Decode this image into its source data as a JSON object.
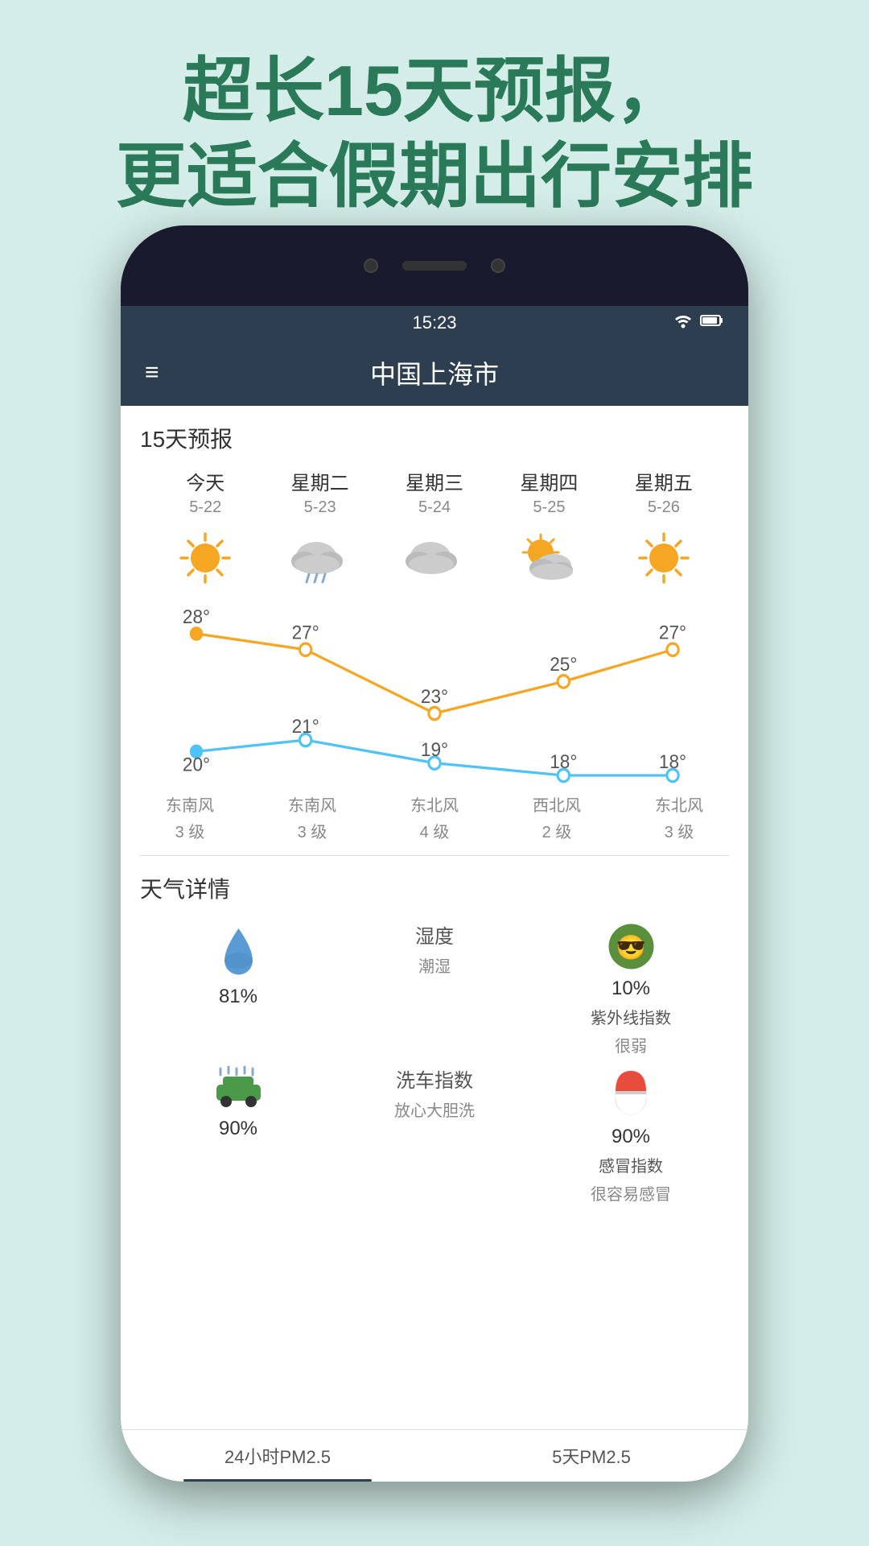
{
  "page": {
    "bg_color": "#d4ede8",
    "header_line1": "超长15天预报，",
    "header_line2": "更适合假期出行安排"
  },
  "status_bar": {
    "time": "15:23",
    "wifi_icon": "📶",
    "battery_icon": "🔋"
  },
  "app_header": {
    "menu_icon": "≡",
    "city": "中国上海市"
  },
  "forecast": {
    "section_title": "15天预报",
    "days": [
      {
        "name": "今天",
        "date": "5-22",
        "weather": "sunny",
        "high": "28°",
        "low": "20°",
        "wind_dir": "东南风",
        "wind_level": "3 级"
      },
      {
        "name": "星期二",
        "date": "5-23",
        "weather": "rainy_cloud",
        "high": "27°",
        "low": "21°",
        "wind_dir": "东南风",
        "wind_level": "3 级"
      },
      {
        "name": "星期三",
        "date": "5-24",
        "weather": "cloudy",
        "high": "23°",
        "low": "19°",
        "wind_dir": "东北风",
        "wind_level": "4 级"
      },
      {
        "name": "星期四",
        "date": "5-25",
        "weather": "partly_cloudy",
        "high": "25°",
        "low": "18°",
        "wind_dir": "西北风",
        "wind_level": "2 级"
      },
      {
        "name": "星期五",
        "date": "5-26",
        "weather": "sunny",
        "high": "27°",
        "low": "18°",
        "wind_dir": "东北风",
        "wind_level": "3 级"
      }
    ],
    "high_color": "#f5a623",
    "low_color": "#4fc3f7"
  },
  "details": {
    "section_title": "天气详情",
    "items": [
      {
        "icon": "droplet",
        "value": "81%",
        "label": "",
        "sublabel": ""
      },
      {
        "icon": "none",
        "value": "湿度",
        "label": "潮湿",
        "sublabel": ""
      },
      {
        "icon": "sunglasses",
        "value": "10%",
        "label": "紫外线指数",
        "sublabel": "很弱"
      },
      {
        "icon": "car_wash",
        "value": "90%",
        "label": "洗车指数",
        "sublabel": "放心大胆洗"
      },
      {
        "icon": "none",
        "value": "",
        "label": "感冒指数",
        "sublabel": ""
      },
      {
        "icon": "pill",
        "value": "90%",
        "label": "",
        "sublabel": "很容易感冒"
      }
    ]
  },
  "bottom_tabs": [
    {
      "label": "24小时PM2.5",
      "active": true
    },
    {
      "label": "5天PM2.5",
      "active": false
    }
  ]
}
